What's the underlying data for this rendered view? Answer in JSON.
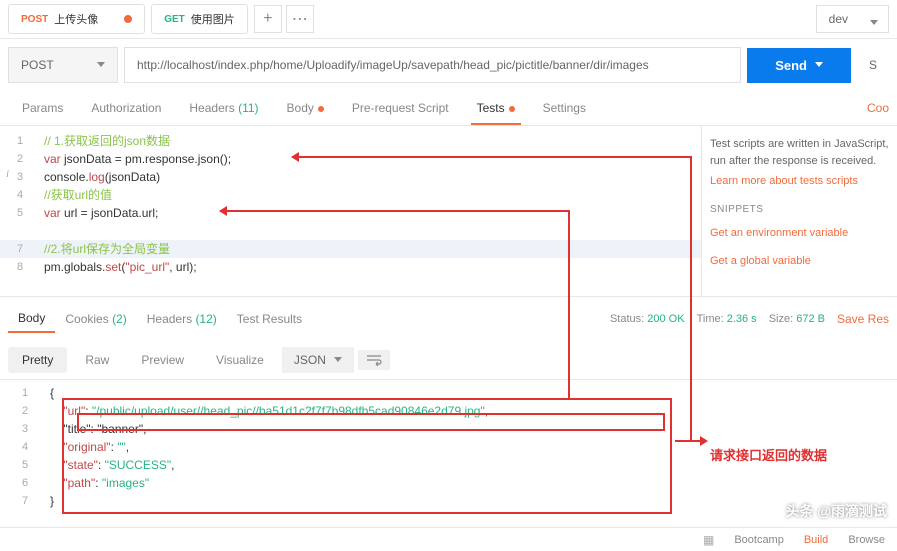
{
  "tabs": [
    {
      "method": "POST",
      "label": "上传头像",
      "dot": true
    },
    {
      "method": "GET",
      "label": "使用图片",
      "dot": false
    }
  ],
  "env": "dev",
  "request": {
    "method": "POST",
    "url": "http://localhost/index.php/home/Uploadify/imageUp/savepath/head_pic/pictitle/banner/dir/images"
  },
  "send_label": "Send",
  "save_label": "S",
  "nav": {
    "params": "Params",
    "auth": "Authorization",
    "headers": "Headers",
    "headers_count": "(11)",
    "body": "Body",
    "prereq": "Pre-request Script",
    "tests": "Tests",
    "settings": "Settings",
    "cookies": "Coo"
  },
  "code": [
    "// 1.获取返回的json数据",
    "var jsonData = pm.response.json();",
    "console.log(jsonData)",
    "//获取url的值",
    "var url = jsonData.url;",
    "",
    "//2.将url保存为全局变量",
    " pm.globals.set(\"pic_url\", url);"
  ],
  "sidebar": {
    "desc": "Test scripts are written in JavaScript, run after the response is received.",
    "learn": "Learn more about tests scripts",
    "snippets": "SNIPPETS",
    "link1": "Get an environment variable",
    "link2": "Get a global variable"
  },
  "response": {
    "tabs": {
      "body": "Body",
      "cookies": "Cookies",
      "cookies_count": "(2)",
      "headers": "Headers",
      "headers_count": "(12)",
      "testresults": "Test Results"
    },
    "status_label": "Status:",
    "status": "200 OK",
    "time_label": "Time:",
    "time": "2.36 s",
    "size_label": "Size:",
    "size": "672 B",
    "save": "Save Res"
  },
  "tools": {
    "pretty": "Pretty",
    "raw": "Raw",
    "preview": "Preview",
    "visualize": "Visualize",
    "format": "JSON"
  },
  "json_body": {
    "url": "/public/upload/user//head_pic//ba51d1c2f7f7b98dfb5cad90846e2d79.jpg",
    "title": "banner",
    "original": "",
    "state": "SUCCESS",
    "path": "images"
  },
  "annotation": "请求接口返回的数据",
  "watermark": "头条 @雨滴测试",
  "bottom": {
    "bootcamp": "Bootcamp",
    "build": "Build",
    "browse": "Browse"
  }
}
